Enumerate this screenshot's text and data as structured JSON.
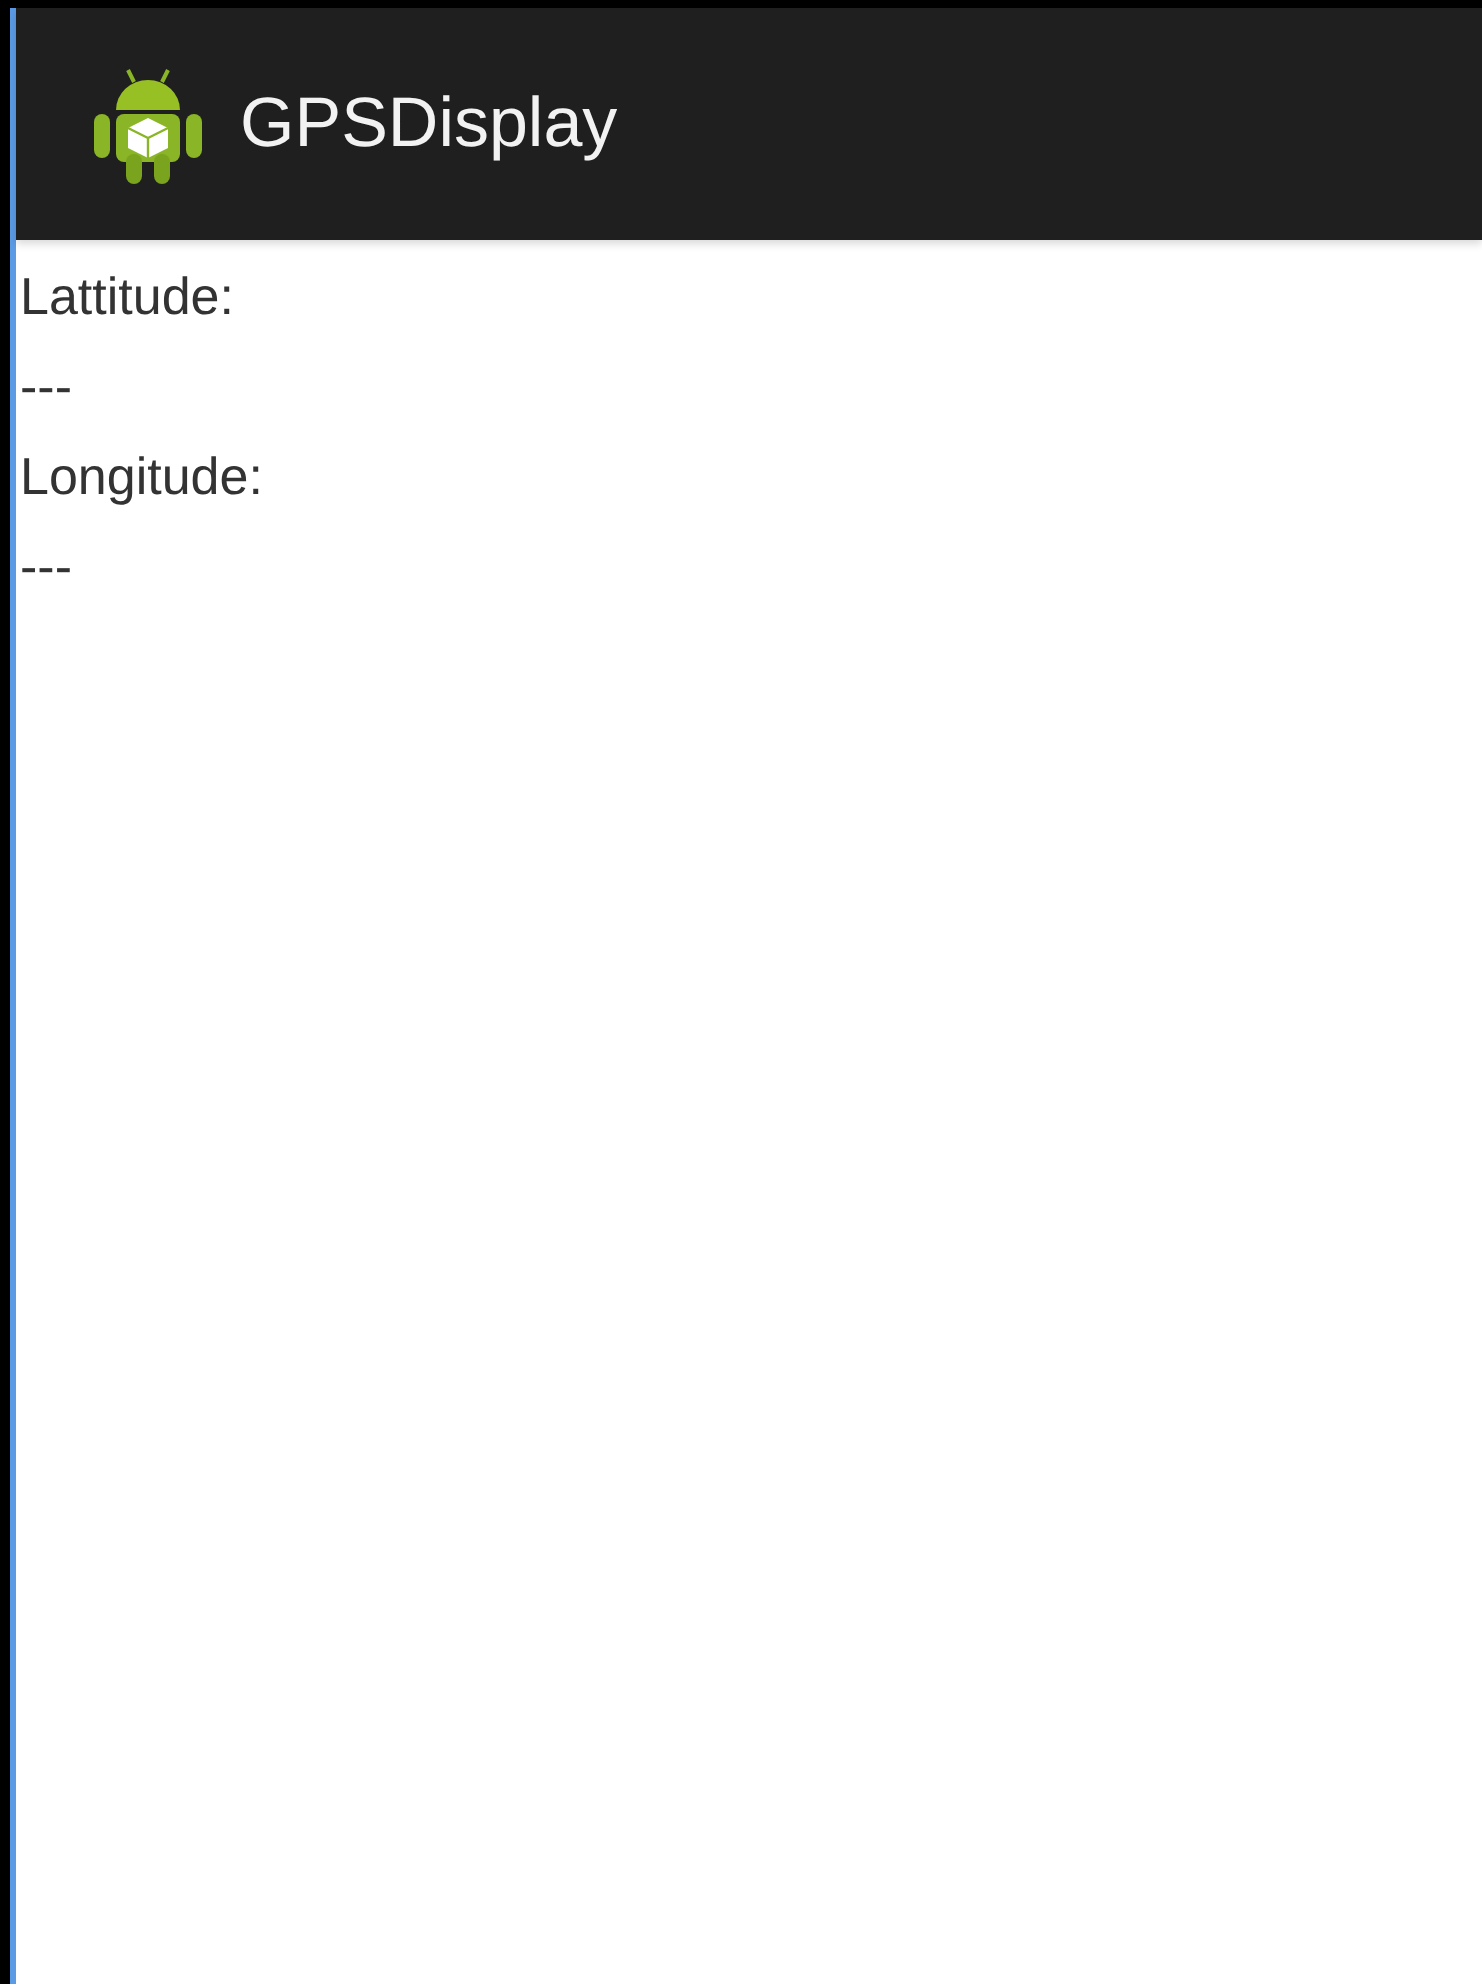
{
  "action_bar": {
    "title": "GPSDisplay"
  },
  "fields": [
    {
      "label": "Lattitude:",
      "value": "---"
    },
    {
      "label": "Longitude:",
      "value": "---"
    }
  ]
}
